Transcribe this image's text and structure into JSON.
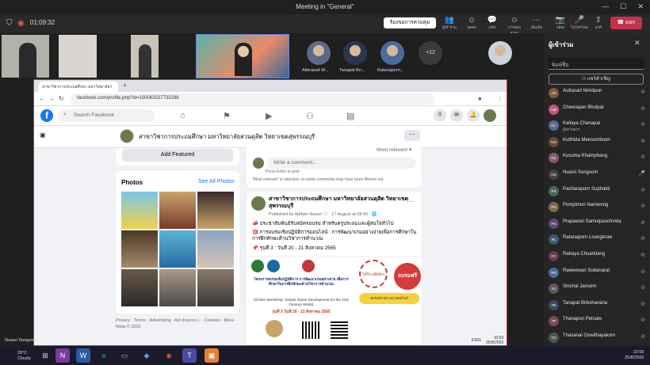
{
  "teams": {
    "window_title": "Meeting in \"General\"",
    "timer": "01:09:32",
    "request_btn": "ร้องขอการควบคุม",
    "toolbar": [
      {
        "label": "ผู้เข้าร่วม",
        "g": "👥"
      },
      {
        "label": "บุคคล",
        "g": "☺"
      },
      {
        "label": "แชท",
        "g": "💬"
      },
      {
        "label": "การตอบสนอง",
        "g": "☺"
      },
      {
        "label": "เพิ่มเติม",
        "g": "⋯"
      },
      {
        "label": "กล้อง",
        "g": "📷"
      },
      {
        "label": "ไมโครโฟน",
        "g": "🎤"
      },
      {
        "label": "แชร์",
        "g": "⇪"
      }
    ],
    "leave": "ออก",
    "my_name": "Nuasri Songsom"
  },
  "video": {
    "people": [
      {
        "name": "Akkrawat W..."
      },
      {
        "name": "Tanapat Bri..."
      },
      {
        "name": "Ratanaporn..."
      }
    ],
    "more_count": "+12"
  },
  "browser": {
    "tab_title": "สาขาวิชาการประถมศึกษา มหาวิทยาลัยฯ",
    "url": "facebook.com/profile.php?id=100063537733298"
  },
  "facebook": {
    "search_placeholder": "Search Facebook",
    "page_name": "สาขาวิชาการประถมศึกษา มหาวิทยาลัยสวนดุสิต วิทยาเขตสุพรรณบุรี",
    "add_featured": "Add Featured",
    "photos_title": "Photos",
    "see_all": "See All Photos",
    "footer": "Privacy · Terms · Advertising · Ad choices ▷ · Cookies · More · Meta © 2022",
    "most_relevant": "Most relevant ▾",
    "write_comment": "Write a comment...",
    "press_enter": "Press Enter to post.",
    "filtered": "\"Most relevant\" is selected, so some comments may have been filtered out.",
    "post": {
      "name": "สาขาวิชาการประถมศึกษา มหาวิทยาลัยสวนดุสิต วิทยาเขตสุพรรณบุรี",
      "by": "Published by AjMam Nuasri ⓘ · 17 August at 08:56 · 🌐",
      "line1": "📣 ประชาสัมพันธ์รับสมัครอบรม สำหรับครูประถมและผู้สนใจทั่วไป",
      "line2": "🎯 การอบรมเชิงปฏิบัติการออนไลน์ : การพัฒนาเกมอย่างง่ายเพื่อการศึกษาในการฝึกทักษะด้านวิชาการคำนวณ",
      "line3": "📌 รุ่นที่ 3 : วันที่ 20 - 21 สิงหาคม 2565",
      "poster_title": "โครงการอบรมเชิงปฏิบัติการ การพัฒนาเกมอย่างง่าย เพื่อการศึกษาในการฝึกทักษะด้านวิชาการคำนวณ",
      "poster_en": "(Online Workshop: Simple Game Development for the 21st Century World)",
      "poster_date": "รุ่นที่ 3 วันที่ 20 - 21 สิงหาคม 2565",
      "poster_free": "อบรมฟรี",
      "poster_online": "อบรมผ่านระบบ ออนไลน์",
      "poster_badge": "ได้รับวุฒิบัตร"
    }
  },
  "participants": {
    "title": "ผู้เข้าร่วม",
    "search": "พิมพ์ชื่อ",
    "share": "แชร์คำเชิญ",
    "list": [
      {
        "name": "Auttasart Nimitpun",
        "initials": "AN",
        "color": "#7a5c3c"
      },
      {
        "name": "Cheerapan Bhulpat",
        "initials": "CB",
        "color": "#c2567a"
      },
      {
        "name": "Kallaya Chanapai",
        "sub": "ผู้จัดวิทยกร",
        "initials": "KC",
        "color": "#5a6a8a"
      },
      {
        "name": "Kulthida Meesomboon",
        "initials": "KM",
        "color": "#6a4a3a"
      },
      {
        "name": "Kusuma Khamphang",
        "initials": "KK",
        "color": "#8a5a6a"
      },
      {
        "name": "Nuasri Songsom",
        "initials": "NS",
        "color": "#444"
      },
      {
        "name": "Pacharaporn Suphakit",
        "initials": "PS",
        "color": "#4a6a5a"
      },
      {
        "name": "Pompimon Namwong",
        "initials": "PN",
        "color": "#7a6a4a"
      },
      {
        "name": "Prapawan Samutpaochinda",
        "initials": "PS",
        "color": "#5a4a7a"
      },
      {
        "name": "Ratanaporn Loungkraw",
        "initials": "RL",
        "color": "#3a5a7a"
      },
      {
        "name": "Rattaya Chuarklang",
        "initials": "RC",
        "color": "#6a3a4a"
      },
      {
        "name": "Raweewan Subanarat",
        "initials": "RS",
        "color": "#4c6b9a"
      },
      {
        "name": "Sinchai Jansem",
        "initials": "SJ",
        "color": "#5a5a5a"
      },
      {
        "name": "Tanapat Brikshavana",
        "initials": "TB",
        "color": "#3a4a6a"
      },
      {
        "name": "Thanapun Petsate",
        "initials": "TP",
        "color": "#7a4a5a"
      },
      {
        "name": "Thasanai Gowithayakorn",
        "initials": "TG",
        "color": "#4a5a4a"
      }
    ]
  },
  "system": {
    "weather_temp": "29°C",
    "weather_desc": "Cloudy",
    "lang": "ENG",
    "time": "10:59",
    "date": "25/8/2565"
  }
}
